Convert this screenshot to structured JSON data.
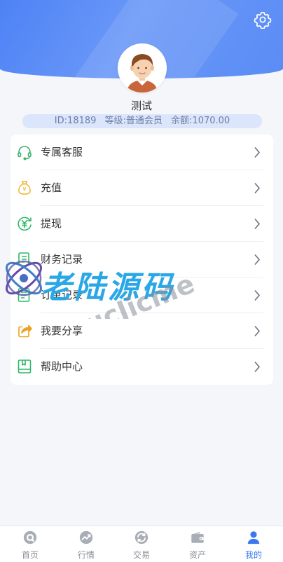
{
  "profile": {
    "nickname": "测试",
    "id_text": "ID:18189",
    "level_text": "等级:普通会员",
    "balance_text": "余额:1070.00"
  },
  "menu": [
    {
      "label": "专属客服",
      "icon": "headset-icon",
      "color": "#3cb371"
    },
    {
      "label": "充值",
      "icon": "money-bag-icon",
      "color": "#f0b429"
    },
    {
      "label": "提现",
      "icon": "yuan-withdraw-icon",
      "color": "#2fb86a"
    },
    {
      "label": "财务记录",
      "icon": "finance-doc-icon",
      "color": "#2fb86a"
    },
    {
      "label": "订单记录",
      "icon": "order-list-icon",
      "color": "#2fb86a"
    },
    {
      "label": "我要分享",
      "icon": "share-icon",
      "color": "#f0a020"
    },
    {
      "label": "帮助中心",
      "icon": "help-book-icon",
      "color": "#2fb86a"
    }
  ],
  "watermark": {
    "title": "老陆源码",
    "subtitle": "ucJicme"
  },
  "tabbar": [
    {
      "label": "首页",
      "icon": "home-icon",
      "active": false
    },
    {
      "label": "行情",
      "icon": "trend-icon",
      "active": false
    },
    {
      "label": "交易",
      "icon": "exchange-icon",
      "active": false
    },
    {
      "label": "资产",
      "icon": "wallet-icon",
      "active": false
    },
    {
      "label": "我的",
      "icon": "user-icon",
      "active": true
    }
  ],
  "colors": {
    "header": "#5a8cf5",
    "accent": "#3b78f0",
    "tab_inactive": "#8a8f99"
  }
}
